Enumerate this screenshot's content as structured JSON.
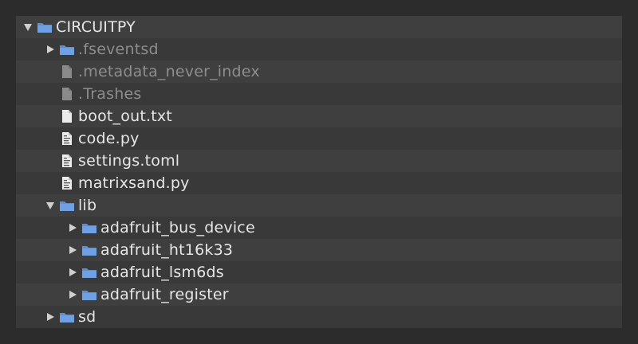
{
  "tree": {
    "root": {
      "label": "CIRCUITPY",
      "icon": "folder-icon",
      "expanded": true
    },
    "items": [
      {
        "label": ".fseventsd",
        "icon": "folder-icon",
        "expanded": false,
        "dim": true
      },
      {
        "label": ".metadata_never_index",
        "icon": "file-icon",
        "dim": true
      },
      {
        "label": ".Trashes",
        "icon": "file-icon",
        "dim": true
      },
      {
        "label": "boot_out.txt",
        "icon": "text-file-icon"
      },
      {
        "label": "code.py",
        "icon": "code-file-icon"
      },
      {
        "label": "settings.toml",
        "icon": "code-file-icon"
      },
      {
        "label": "matrixsand.py",
        "icon": "code-file-icon"
      },
      {
        "label": "lib",
        "icon": "folder-icon",
        "expanded": true,
        "children": [
          {
            "label": "adafruit_bus_device",
            "icon": "folder-icon",
            "expanded": false
          },
          {
            "label": "adafruit_ht16k33",
            "icon": "folder-icon",
            "expanded": false
          },
          {
            "label": "adafruit_lsm6ds",
            "icon": "folder-icon",
            "expanded": false
          },
          {
            "label": "adafruit_register",
            "icon": "folder-icon",
            "expanded": false
          }
        ]
      },
      {
        "label": "sd",
        "icon": "folder-icon",
        "expanded": false
      }
    ]
  },
  "colors": {
    "background": "#2c2c2c",
    "panel": "#393939",
    "row_alt": "#3f3f3f",
    "text": "#e6e6e6",
    "text_dim": "#8d8d8d",
    "folder": "#5b8fd6"
  }
}
